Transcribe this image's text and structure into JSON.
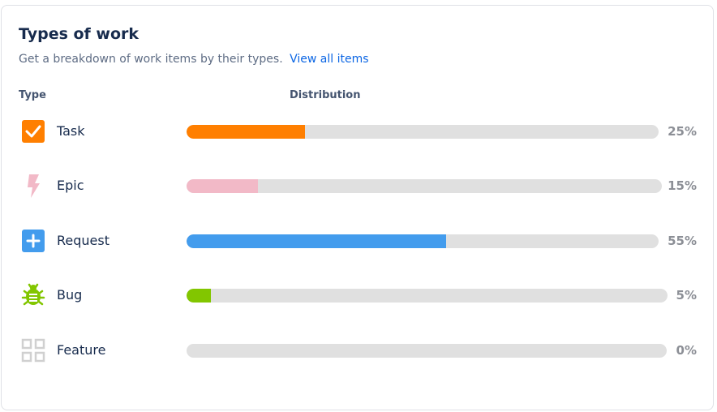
{
  "card": {
    "title": "Types of work",
    "subtitle": "Get a breakdown of work items by their types.",
    "link": "View all items"
  },
  "headers": {
    "type": "Type",
    "distribution": "Distribution"
  },
  "rows": [
    {
      "label": "Task",
      "percent_label": "25%",
      "percent": 25,
      "color": "#ff7f00",
      "icon": "task-checkbox-icon"
    },
    {
      "label": "Epic",
      "percent_label": "15%",
      "percent": 15,
      "color": "#f2b9c7",
      "icon": "epic-lightning-icon"
    },
    {
      "label": "Request",
      "percent_label": "55%",
      "percent": 55,
      "color": "#439ced",
      "icon": "request-plus-icon"
    },
    {
      "label": "Bug",
      "percent_label": "5%",
      "percent": 5,
      "color": "#82c600",
      "icon": "bug-icon"
    },
    {
      "label": "Feature",
      "percent_label": "0%",
      "percent": 0,
      "color": "#d0d0d0",
      "icon": "feature-grid-icon"
    }
  ]
}
